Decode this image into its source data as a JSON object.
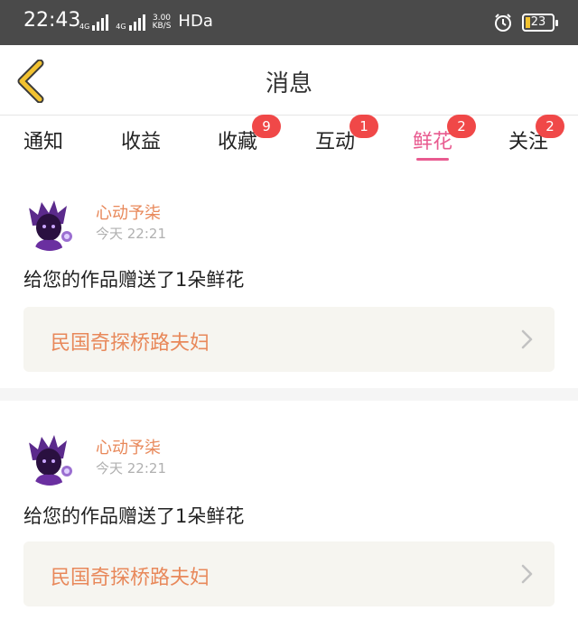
{
  "status_bar": {
    "time": "22:43",
    "net_tag_1": "4G",
    "net_tag_2": "4G",
    "speed_value": "3.00",
    "speed_unit": "KB/S",
    "hd": "HDa",
    "battery_level": "23",
    "icons": [
      "signal-icon",
      "alarm-icon",
      "battery-icon"
    ]
  },
  "header": {
    "back_icon": "chevron-left-icon",
    "title": "消息"
  },
  "tabs": [
    {
      "label": "通知",
      "badge": ""
    },
    {
      "label": "收益",
      "badge": ""
    },
    {
      "label": "收藏",
      "badge": "9"
    },
    {
      "label": "互动",
      "badge": "1"
    },
    {
      "label": "鲜花",
      "badge": "2",
      "active": true
    },
    {
      "label": "关注",
      "badge": "2"
    }
  ],
  "notifications": [
    {
      "username": "心动予柒",
      "time": "今天 22:21",
      "message": "给您的作品赠送了1朵鲜花",
      "work_title": "民国奇探桥路夫妇"
    },
    {
      "username": "心动予柒",
      "time": "今天 22:21",
      "message": "给您的作品赠送了1朵鲜花",
      "work_title": "民国奇探桥路夫妇"
    }
  ],
  "colors": {
    "accent": "#e85a8f",
    "username": "#e8885a",
    "badge": "#f04848",
    "back_icon": "#f2c230",
    "status_bar": "#4a4a4a"
  }
}
